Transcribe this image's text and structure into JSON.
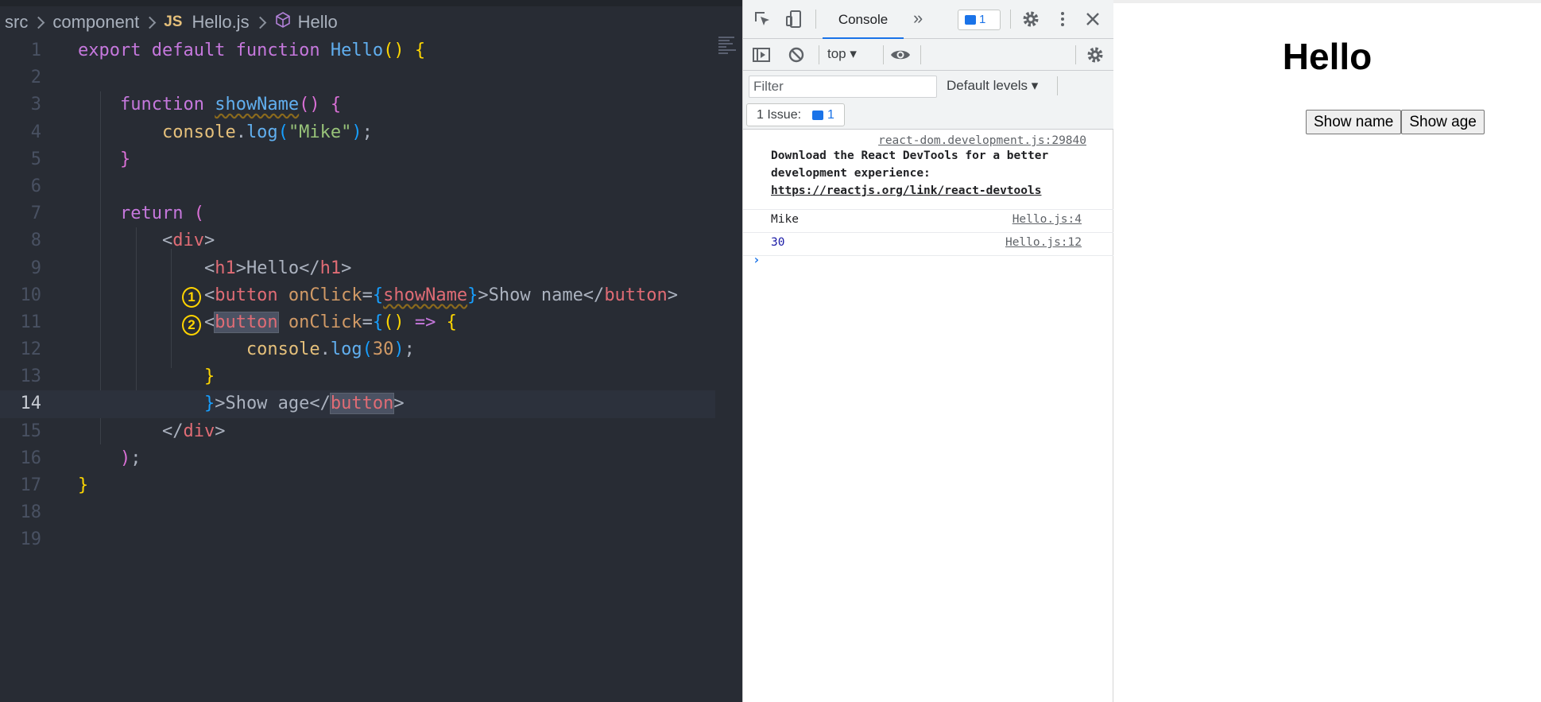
{
  "editor": {
    "breadcrumb": {
      "folder1": "src",
      "folder2": "component",
      "file_type": "JS",
      "file": "Hello.js",
      "symbol": "Hello"
    },
    "line_numbers": [
      "1",
      "2",
      "3",
      "4",
      "5",
      "6",
      "7",
      "8",
      "9",
      "10",
      "11",
      "12",
      "13",
      "14",
      "15",
      "16",
      "17",
      "18",
      "19"
    ],
    "current_line": "14",
    "code_lines": [
      "export default function Hello() {",
      "",
      "    function showName() {",
      "        console.log(\"Mike\");",
      "    }",
      "",
      "    return (",
      "        <div>",
      "            <h1>Hello</h1>",
      "            <button onClick={showName}>Show name</button>",
      "            <button onClick={() => {",
      "                console.log(30);",
      "            }",
      "            }>Show age</button>",
      "        </div>",
      "    );",
      "}",
      "",
      ""
    ],
    "annotations": [
      "1",
      "2"
    ]
  },
  "devtools": {
    "tab_console": "Console",
    "more_tabs": "»",
    "issues_badge_count": "1",
    "context": "top",
    "filter_placeholder": "Filter",
    "levels": "Default levels",
    "issues_label": "1 Issue:",
    "issues_count": "1",
    "messages": [
      {
        "source": "react-dom.development.js:29840",
        "text": "Download the React DevTools for a better development experience:",
        "link": "https://reactjs.org/link/react-devtools"
      },
      {
        "value": "Mike",
        "source": "Hello.js:4"
      },
      {
        "value": "30",
        "source": "Hello.js:12"
      }
    ],
    "prompt": "›",
    "colors": {
      "accent": "#1a73e8"
    }
  },
  "preview": {
    "heading": "Hello",
    "buttons": [
      "Show name",
      "Show age"
    ]
  },
  "icons": [
    "inspect-icon",
    "device-toggle-icon",
    "settings-icon",
    "more-vert-icon",
    "close-icon",
    "sidebar-toggle-icon",
    "clear-console-icon",
    "eye-icon",
    "console-settings-icon",
    "issues-icon",
    "component-icon"
  ]
}
